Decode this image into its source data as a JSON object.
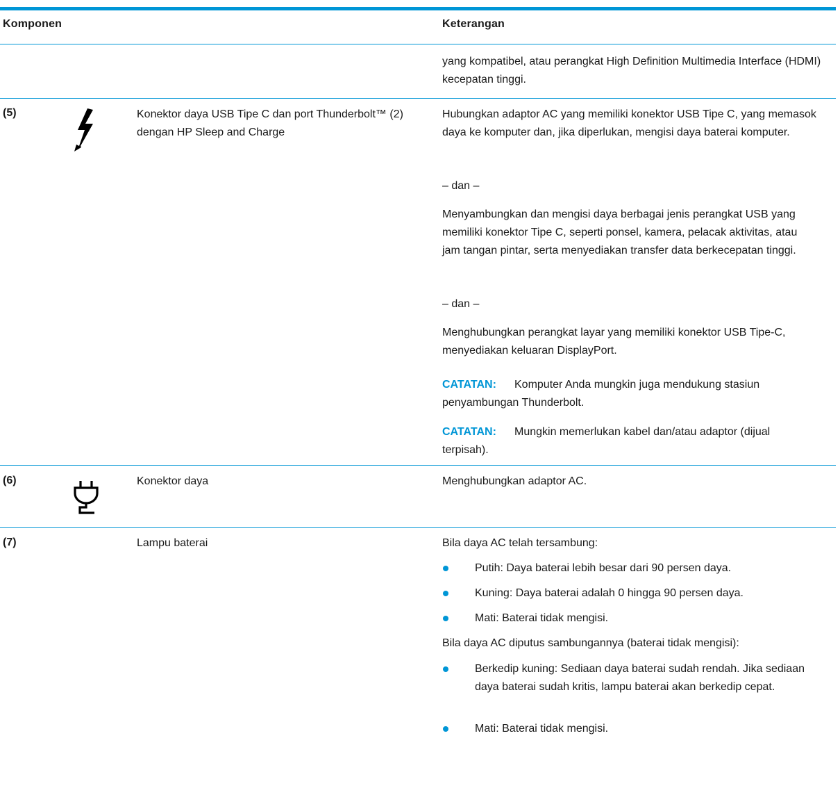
{
  "header": {
    "col_component": "Komponen",
    "col_description": "Keterangan"
  },
  "continuation": {
    "desc": "yang kompatibel, atau perangkat High Definition Multimedia Interface (HDMI) kecepatan tinggi."
  },
  "rows": [
    {
      "number": "(5)",
      "icon": "thunderbolt-icon",
      "component": "Konektor daya USB Tipe C dan port Thunderbolt™ (2) dengan HP Sleep and Charge",
      "desc1": "Hubungkan adaptor AC yang memiliki konektor USB Tipe C, yang memasok daya ke komputer dan, jika diperlukan, mengisi daya baterai komputer.",
      "sep1": "– dan –",
      "desc2": "Menyambungkan dan mengisi daya berbagai jenis perangkat USB yang memiliki konektor Tipe C, seperti ponsel, kamera, pelacak aktivitas, atau jam tangan pintar, serta menyediakan transfer data berkecepatan tinggi.",
      "sep2": "– dan –",
      "desc3": "Menghubungkan perangkat layar yang memiliki konektor USB Tipe-C, menyediakan keluaran DisplayPort.",
      "note_label": "CATATAN:",
      "note1": "Komputer Anda mungkin juga mendukung stasiun penyambungan Thunderbolt.",
      "note2": "Mungkin memerlukan kabel dan/atau adaptor (dijual terpisah)."
    },
    {
      "number": "(6)",
      "icon": "power-plug-icon",
      "component": "Konektor daya",
      "desc": "Menghubungkan adaptor AC."
    },
    {
      "number": "(7)",
      "component": "Lampu baterai",
      "intro_ac": "Bila daya AC telah tersambung:",
      "ac_items": [
        "Putih: Daya baterai lebih besar dari 90 persen daya.",
        "Kuning: Daya baterai adalah 0 hingga 90 persen daya.",
        "Mati: Baterai tidak mengisi."
      ],
      "intro_battery": "Bila daya AC diputus sambungannya (baterai tidak mengisi):",
      "battery_items": [
        "Berkedip kuning: Sediaan daya baterai sudah rendah. Jika sediaan daya baterai sudah kritis, lampu baterai akan berkedip cepat.",
        "Mati: Baterai tidak mengisi."
      ]
    }
  ],
  "colors": {
    "accent": "#0096d6",
    "text": "#1a1a1a"
  }
}
